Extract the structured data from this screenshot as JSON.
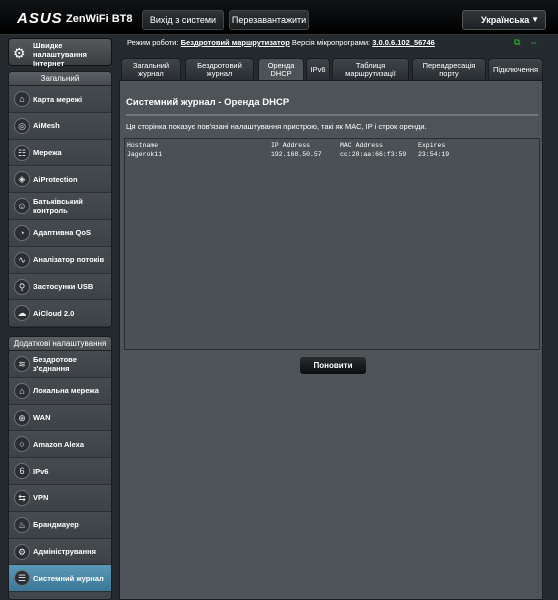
{
  "header": {
    "brand": "ASUS",
    "model": "ZenWiFi BT8",
    "logout_label": "Вихід з системи",
    "reboot_label": "Перезавантажити",
    "language": "Українська"
  },
  "status": {
    "mode_label": "Режим роботи:",
    "mode_value": "Бездротовий маршрутизатор",
    "firmware_label": "Версія мікропрограми:",
    "firmware_value": "3.0.0.6.102_56746"
  },
  "sidebar": {
    "quick_setup_label": "Швидке налаштування Інтернет",
    "general_heading": "Загальний",
    "general_items": [
      {
        "label": "Карта мережі",
        "icon": "network-map-icon"
      },
      {
        "label": "AiMesh",
        "icon": "aimesh-icon"
      },
      {
        "label": "Мережа",
        "icon": "network-icon"
      },
      {
        "label": "AiProtection",
        "icon": "shield-icon"
      },
      {
        "label": "Батьківський контроль",
        "icon": "family-icon"
      },
      {
        "label": "Адаптивна QoS",
        "icon": "speedometer-icon"
      },
      {
        "label": "Аналізатор потоків",
        "icon": "traffic-analyzer-icon"
      },
      {
        "label": "Застосунки USB",
        "icon": "usb-icon"
      },
      {
        "label": "AiCloud 2.0",
        "icon": "cloud-icon"
      }
    ],
    "advanced_heading": "Додаткові налаштування",
    "advanced_items": [
      {
        "label": "Бездротове з'єднання",
        "icon": "wireless-icon"
      },
      {
        "label": "Локальна мережа",
        "icon": "lan-icon"
      },
      {
        "label": "WAN",
        "icon": "globe-icon"
      },
      {
        "label": "Amazon Alexa",
        "icon": "alexa-icon"
      },
      {
        "label": "IPv6",
        "icon": "ipv6-icon"
      },
      {
        "label": "VPN",
        "icon": "vpn-icon"
      },
      {
        "label": "Брандмауер",
        "icon": "firewall-icon"
      },
      {
        "label": "Адміністрування",
        "icon": "admin-icon"
      },
      {
        "label": "Системний журнал",
        "icon": "system-log-icon",
        "active": true
      }
    ]
  },
  "tabs": [
    {
      "label": "Загальний журнал"
    },
    {
      "label": "Бездротовий журнал"
    },
    {
      "label": "Оренда DHCP",
      "active": true
    },
    {
      "label": "IPv6"
    },
    {
      "label": "Таблиця маршрутизації"
    },
    {
      "label": "Переадресація порту"
    },
    {
      "label": "Підключення"
    }
  ],
  "main": {
    "title": "Системний журнал - Оренда DHCP",
    "description": "Ця сторінка показує пов'язані налаштування пристрою, такі як МАС, IP і строк оренди.",
    "table": {
      "columns": [
        "Hostname",
        "IP Address",
        "MAC Address",
        "Expires"
      ],
      "rows": [
        [
          "Jagerok11",
          "192.168.50.57",
          "cc:28:aa:66:f3:59",
          "23:54:19"
        ]
      ]
    },
    "refresh_label": "Поновити"
  }
}
